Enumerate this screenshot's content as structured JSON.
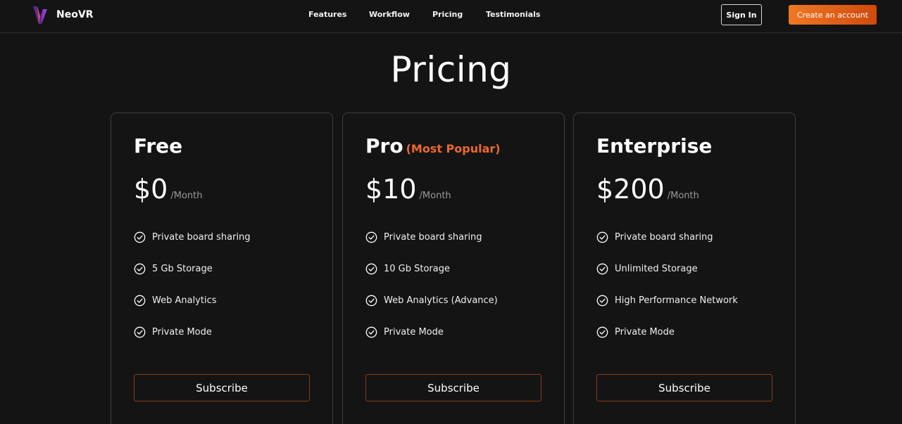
{
  "brand": {
    "name": "NeoVR"
  },
  "nav": {
    "links": [
      "Features",
      "Workflow",
      "Pricing",
      "Testimonials"
    ],
    "sign_in": "Sign In",
    "create_account": "Create an account"
  },
  "page": {
    "title": "Pricing"
  },
  "plans": [
    {
      "name": "Free",
      "tag": "",
      "price": "$0",
      "period": "/Month",
      "features": [
        "Private board sharing",
        "5 Gb Storage",
        "Web Analytics",
        "Private Mode"
      ],
      "button": "Subscribe"
    },
    {
      "name": "Pro",
      "tag": "(Most Popular)",
      "price": "$10",
      "period": "/Month",
      "features": [
        "Private board sharing",
        "10 Gb Storage",
        "Web Analytics (Advance)",
        "Private Mode"
      ],
      "button": "Subscribe"
    },
    {
      "name": "Enterprise",
      "tag": "",
      "price": "$200",
      "period": "/Month",
      "features": [
        "Private board sharing",
        "Unlimited Storage",
        "High Performance Network",
        "Private Mode"
      ],
      "button": "Subscribe"
    }
  ],
  "colors": {
    "background": "#141414",
    "accent": "#ec6a25",
    "card_border": "#3e3e3e"
  },
  "icons": {
    "logo": "neovr-logo-icon",
    "feature": "check-circle-icon"
  }
}
